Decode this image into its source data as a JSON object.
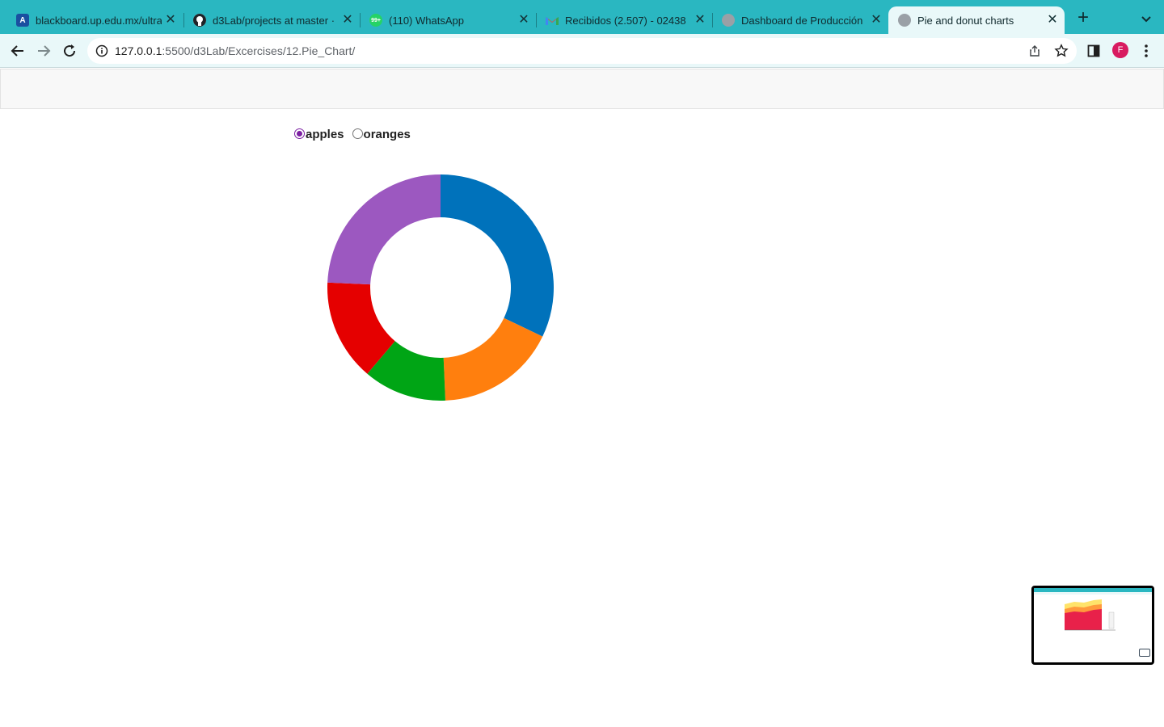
{
  "browser": {
    "tabs": [
      {
        "title": "blackboard.up.edu.mx/ultra",
        "icon": "blackboard-icon",
        "active": false
      },
      {
        "title": "d3Lab/projects at master ·",
        "icon": "github-icon",
        "active": false
      },
      {
        "title": "(110) WhatsApp",
        "icon": "whatsapp-icon",
        "active": false
      },
      {
        "title": "Recibidos (2.507) - 02438",
        "icon": "gmail-icon",
        "active": false
      },
      {
        "title": "Dashboard de Producción",
        "icon": "globe-icon",
        "active": false
      },
      {
        "title": "Pie and donut charts",
        "icon": "globe-icon",
        "active": true
      }
    ],
    "url_host": "127.0.0.1",
    "url_path": ":5500/d3Lab/Excercises/12.Pie_Chart/",
    "profile_initial": "F",
    "tab_badge": "99+"
  },
  "page": {
    "radios": [
      {
        "label": "apples",
        "checked": true
      },
      {
        "label": "oranges",
        "checked": false
      }
    ]
  },
  "colors": {
    "tabstrip": "#2ab7c1",
    "toolbar": "#e9f8f9",
    "radio_accent": "#7b1fa2"
  },
  "chart_data": {
    "type": "pie",
    "variant": "donut",
    "title": "",
    "values": [
      53245,
      28479,
      19697,
      24037,
      40245
    ],
    "colors": [
      "#0072bb",
      "#ff7f0e",
      "#00a515",
      "#e50000",
      "#9c58c0"
    ],
    "start_angle_deg": 0,
    "direction": "clockwise"
  }
}
